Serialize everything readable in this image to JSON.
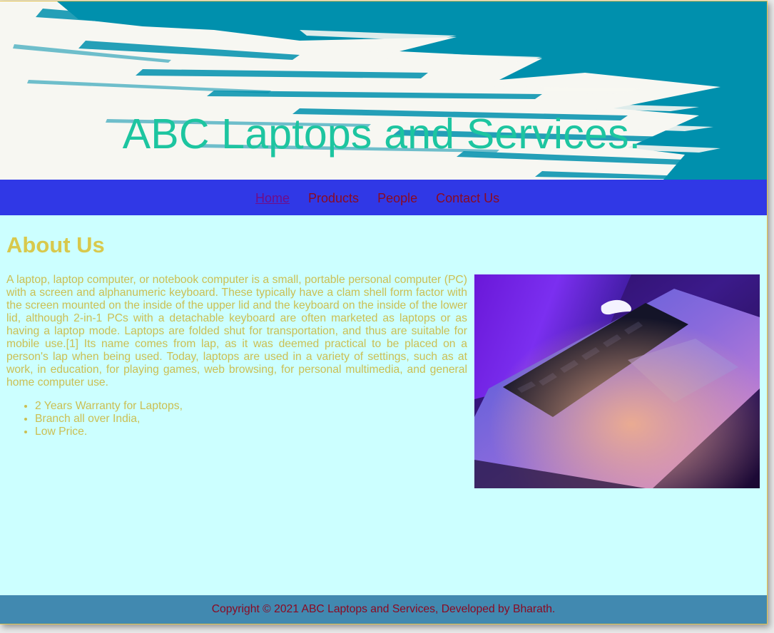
{
  "site": {
    "title": "ABC Laptops and Services."
  },
  "nav": {
    "items": [
      {
        "label": "Home"
      },
      {
        "label": "Products"
      },
      {
        "label": "People"
      },
      {
        "label": "Contact Us"
      }
    ]
  },
  "about": {
    "heading": "About Us",
    "paragraph": "A laptop, laptop computer, or notebook computer is a small, portable personal computer (PC) with a screen and alphanumeric keyboard. These typically have a clam shell form factor with the screen mounted on the inside of the upper lid and the keyboard on the inside of the lower lid, although 2-in-1 PCs with a detachable keyboard are often marketed as laptops or as having a laptop mode. Laptops are folded shut for transportation, and thus are suitable for mobile use.[1] Its name comes from lap, as it was deemed practical to be placed on a person's lap when being used. Today, laptops are used in a variety of settings, such as at work, in education, for playing games, web browsing, for personal multimedia, and general home computer use.",
    "features": [
      "2 Years Warranty for Laptops,",
      "Branch all over India,",
      "Low Price."
    ]
  },
  "footer": {
    "text": "Copyright © 2021 ABC Laptops and Services, Developed by Bharath."
  },
  "colors": {
    "banner_teal": "#0090ad",
    "title": "#1dc5a0",
    "nav_bg": "#3038e6",
    "nav_link": "#8b0a22",
    "nav_active": "#6f0d8a",
    "content_bg": "#ccffff",
    "content_text": "#cbbf52",
    "footer_bg": "#4189b0"
  }
}
